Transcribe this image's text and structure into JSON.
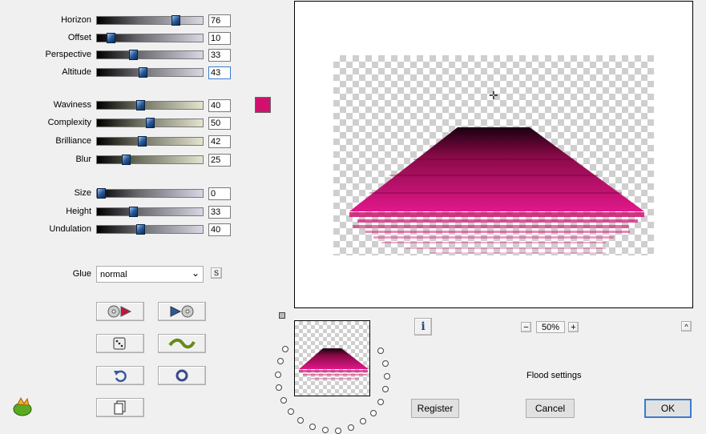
{
  "sliders_group1": [
    {
      "label": "Horizon",
      "value": "76",
      "level": 0.76
    },
    {
      "label": "Offset",
      "value": "10",
      "level": 0.1
    },
    {
      "label": "Perspective",
      "value": "33",
      "level": 0.33
    },
    {
      "label": "Altitude",
      "value": "43",
      "level": 0.43
    }
  ],
  "sliders_group2": [
    {
      "label": "Waviness",
      "value": "40",
      "level": 0.4
    },
    {
      "label": "Complexity",
      "value": "50",
      "level": 0.5
    },
    {
      "label": "Brilliance",
      "value": "42",
      "level": 0.42
    },
    {
      "label": "Blur",
      "value": "25",
      "level": 0.25
    }
  ],
  "sliders_group3": [
    {
      "label": "Size",
      "value": "0",
      "level": 0.0
    },
    {
      "label": "Height",
      "value": "33",
      "level": 0.33
    },
    {
      "label": "Undulation",
      "value": "40",
      "level": 0.4
    }
  ],
  "color_swatch": "#d0126e",
  "glue": {
    "label": "Glue",
    "selected": "normal",
    "s_button": "S"
  },
  "zoom": {
    "minus": "−",
    "value": "50%",
    "plus": "+"
  },
  "info_icon": "i",
  "caret": "^",
  "flood_settings": "Flood settings",
  "buttons": {
    "register": "Register",
    "cancel": "Cancel",
    "ok": "OK"
  },
  "icons": {
    "prev": "prev-disc-icon",
    "next": "next-disc-icon",
    "random": "dice-icon",
    "wave": "wave-icon",
    "undo": "undo-icon",
    "reset": "ring-icon",
    "copy": "copy-icon",
    "logo": "app-logo-icon"
  },
  "colors": {
    "accent": "#d0126e",
    "focus": "#3a7ad0"
  }
}
